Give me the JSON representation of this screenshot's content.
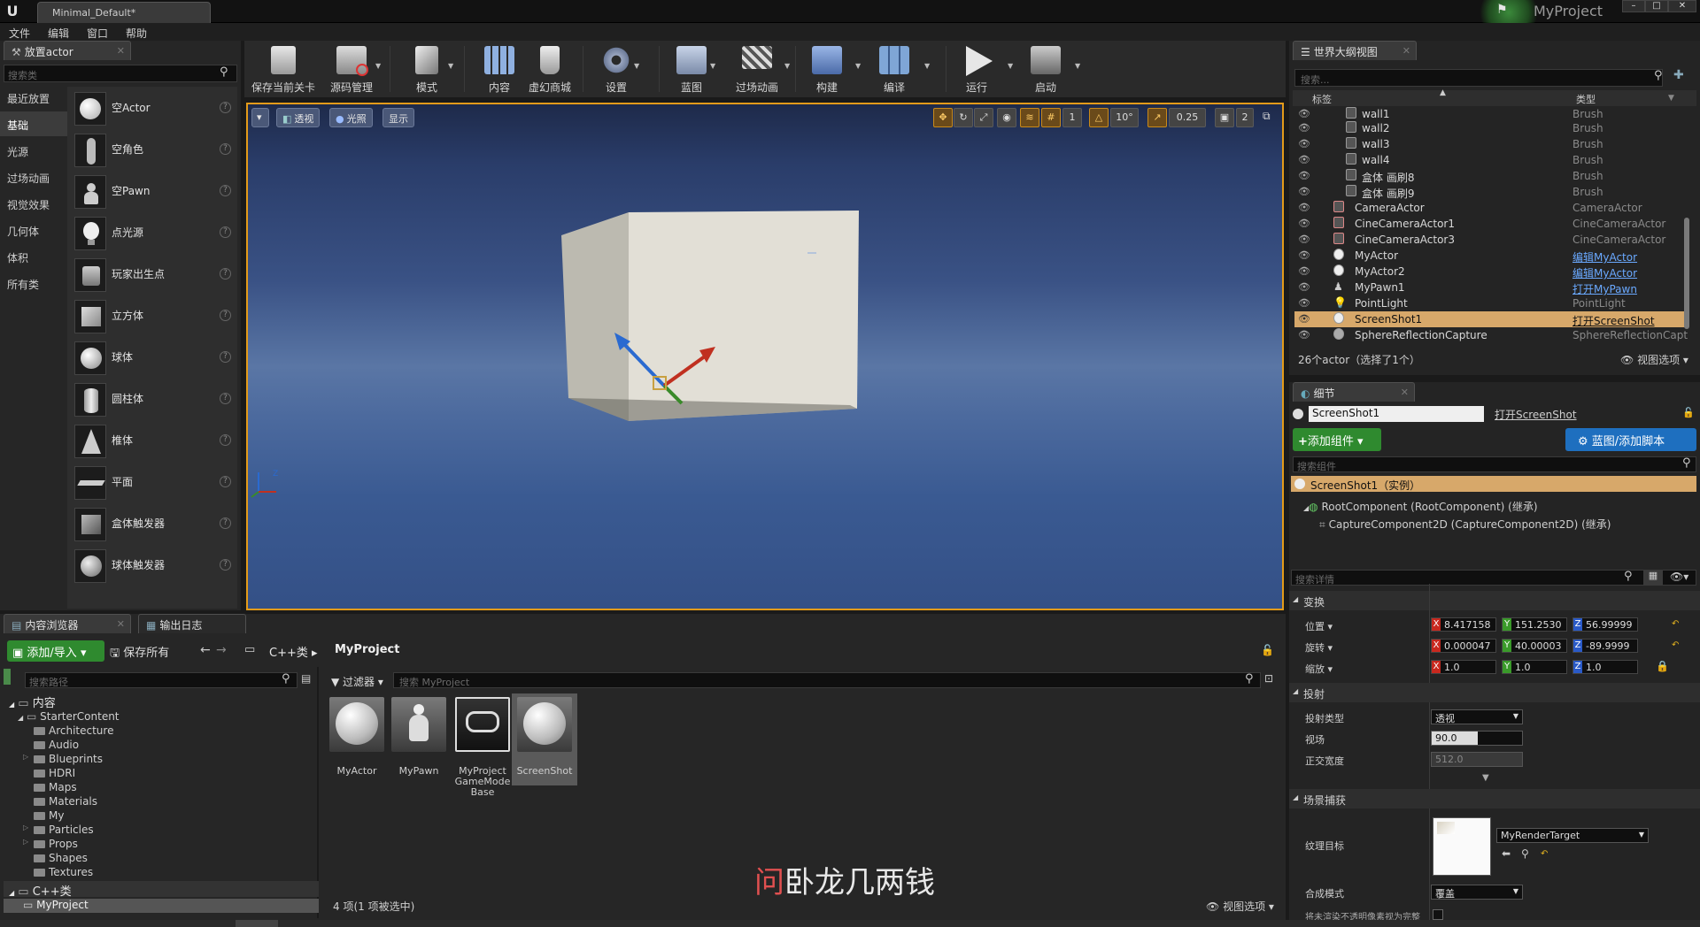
{
  "titlebar": {
    "doc_tab": "Minimal_Default*",
    "project_name": "MyProject"
  },
  "menu": [
    "文件",
    "编辑",
    "窗口",
    "帮助"
  ],
  "place_panel": {
    "tab_title": "放置actor",
    "search_placeholder": "搜索类",
    "categories": [
      "最近放置",
      "基础",
      "光源",
      "过场动画",
      "视觉效果",
      "几何体",
      "体积",
      "所有类"
    ],
    "actors": [
      "空Actor",
      "空角色",
      "空Pawn",
      "点光源",
      "玩家出生点",
      "立方体",
      "球体",
      "圆柱体",
      "椎体",
      "平面",
      "盒体触发器",
      "球体触发器"
    ]
  },
  "toolbar": {
    "buttons": [
      "保存当前关卡",
      "源码管理",
      "模式",
      "内容",
      "虚幻商城",
      "设置",
      "蓝图",
      "过场动画",
      "构建",
      "编译",
      "运行",
      "启动"
    ]
  },
  "viewport": {
    "perspective": "透视",
    "lighting": "光照",
    "show": "显示",
    "rot_snap": "10°",
    "scale_snap": "0.25",
    "cam_speed": "2"
  },
  "outliner": {
    "tab_title": "世界大纲视图",
    "search_placeholder": "搜索...",
    "col_label": "标签",
    "col_type": "类型",
    "rows": [
      {
        "name": "wall1",
        "type": "Brush"
      },
      {
        "name": "wall2",
        "type": "Brush"
      },
      {
        "name": "wall3",
        "type": "Brush"
      },
      {
        "name": "wall4",
        "type": "Brush"
      },
      {
        "name": "盒体 画刷8",
        "type": "Brush"
      },
      {
        "name": "盒体 画刷9",
        "type": "Brush"
      },
      {
        "name": "CameraActor",
        "type": "CameraActor"
      },
      {
        "name": "CineCameraActor1",
        "type": "CineCameraActor"
      },
      {
        "name": "CineCameraActor3",
        "type": "CineCameraActor"
      },
      {
        "name": "MyActor",
        "type": "编辑MyActor"
      },
      {
        "name": "MyActor2",
        "type": "编辑MyActor"
      },
      {
        "name": "MyPawn1",
        "type": "打开MyPawn"
      },
      {
        "name": "PointLight",
        "type": "PointLight"
      },
      {
        "name": "ScreenShot1",
        "type": "打开ScreenShot"
      },
      {
        "name": "SphereReflectionCapture",
        "type": "SphereReflectionCapt"
      }
    ],
    "footer_count": "26个actor（选择了1个）",
    "view_options": "视图选项"
  },
  "details": {
    "tab_title": "细节",
    "object_name": "ScreenShot1",
    "open_link": "打开ScreenShot",
    "add_component": "添加组件",
    "blueprint_button": "蓝图/添加脚本",
    "search_components_placeholder": "搜索组件",
    "instance_label": "ScreenShot1（实例）",
    "root_component": "RootComponent (RootComponent) (继承)",
    "capture_component": "CaptureComponent2D (CaptureComponent2D) (继承)",
    "search_details_placeholder": "搜索详情",
    "transform_header": "变换",
    "location_label": "位置",
    "rotation_label": "旋转",
    "scale_label": "缩放",
    "location": {
      "x": "8.417158",
      "y": "151.2530",
      "z": "56.99999"
    },
    "rotation": {
      "x": "0.000047",
      "y": "40.00003",
      "z": "-89.9999"
    },
    "scale": {
      "x": "1.0",
      "y": "1.0",
      "z": "1.0"
    },
    "projection_header": "投射",
    "projection_type_label": "投射类型",
    "projection_type": "透视",
    "fov_label": "视场",
    "fov": "90.0",
    "ortho_label": "正交宽度",
    "ortho": "512.0",
    "scene_capture_header": "场景捕获",
    "texture_target_label": "纹理目标",
    "texture_target": "MyRenderTarget",
    "composite_label": "合成模式",
    "composite_mode": "覆盖",
    "opaque_label": "将未渲染不透明像素视为完整"
  },
  "content_browser": {
    "tab_title": "内容浏览器",
    "log_tab": "输出日志",
    "add_import": "添加/导入",
    "save_all": "保存所有",
    "path_cpp": "C++类",
    "path_project": "MyProject",
    "search_paths_placeholder": "搜索路径",
    "filter": "过滤器",
    "search_placeholder": "搜索 MyProject",
    "tree": {
      "root": "内容",
      "starter": "StarterContent",
      "folders": [
        "Architecture",
        "Audio",
        "Blueprints",
        "HDRI",
        "Maps",
        "Materials",
        "My",
        "Particles",
        "Props",
        "Shapes",
        "Textures"
      ],
      "cpp_root": "C++类",
      "cpp_project": "MyProject"
    },
    "assets": [
      "MyActor",
      "MyPawn",
      "MyProject GameMode Base",
      "ScreenShot"
    ],
    "status": "4 项(1 项被选中)",
    "view_options": "视图选项"
  },
  "overlay_caption": {
    "first_char": "问",
    "rest": "卧龙几两钱"
  },
  "colors": {
    "accent_orange": "#e39b1a",
    "selected_row": "#d7a86a",
    "link_blue": "#6aa9ff",
    "add_green": "#2f8a2f",
    "blueprint_blue": "#1e6fbf"
  }
}
